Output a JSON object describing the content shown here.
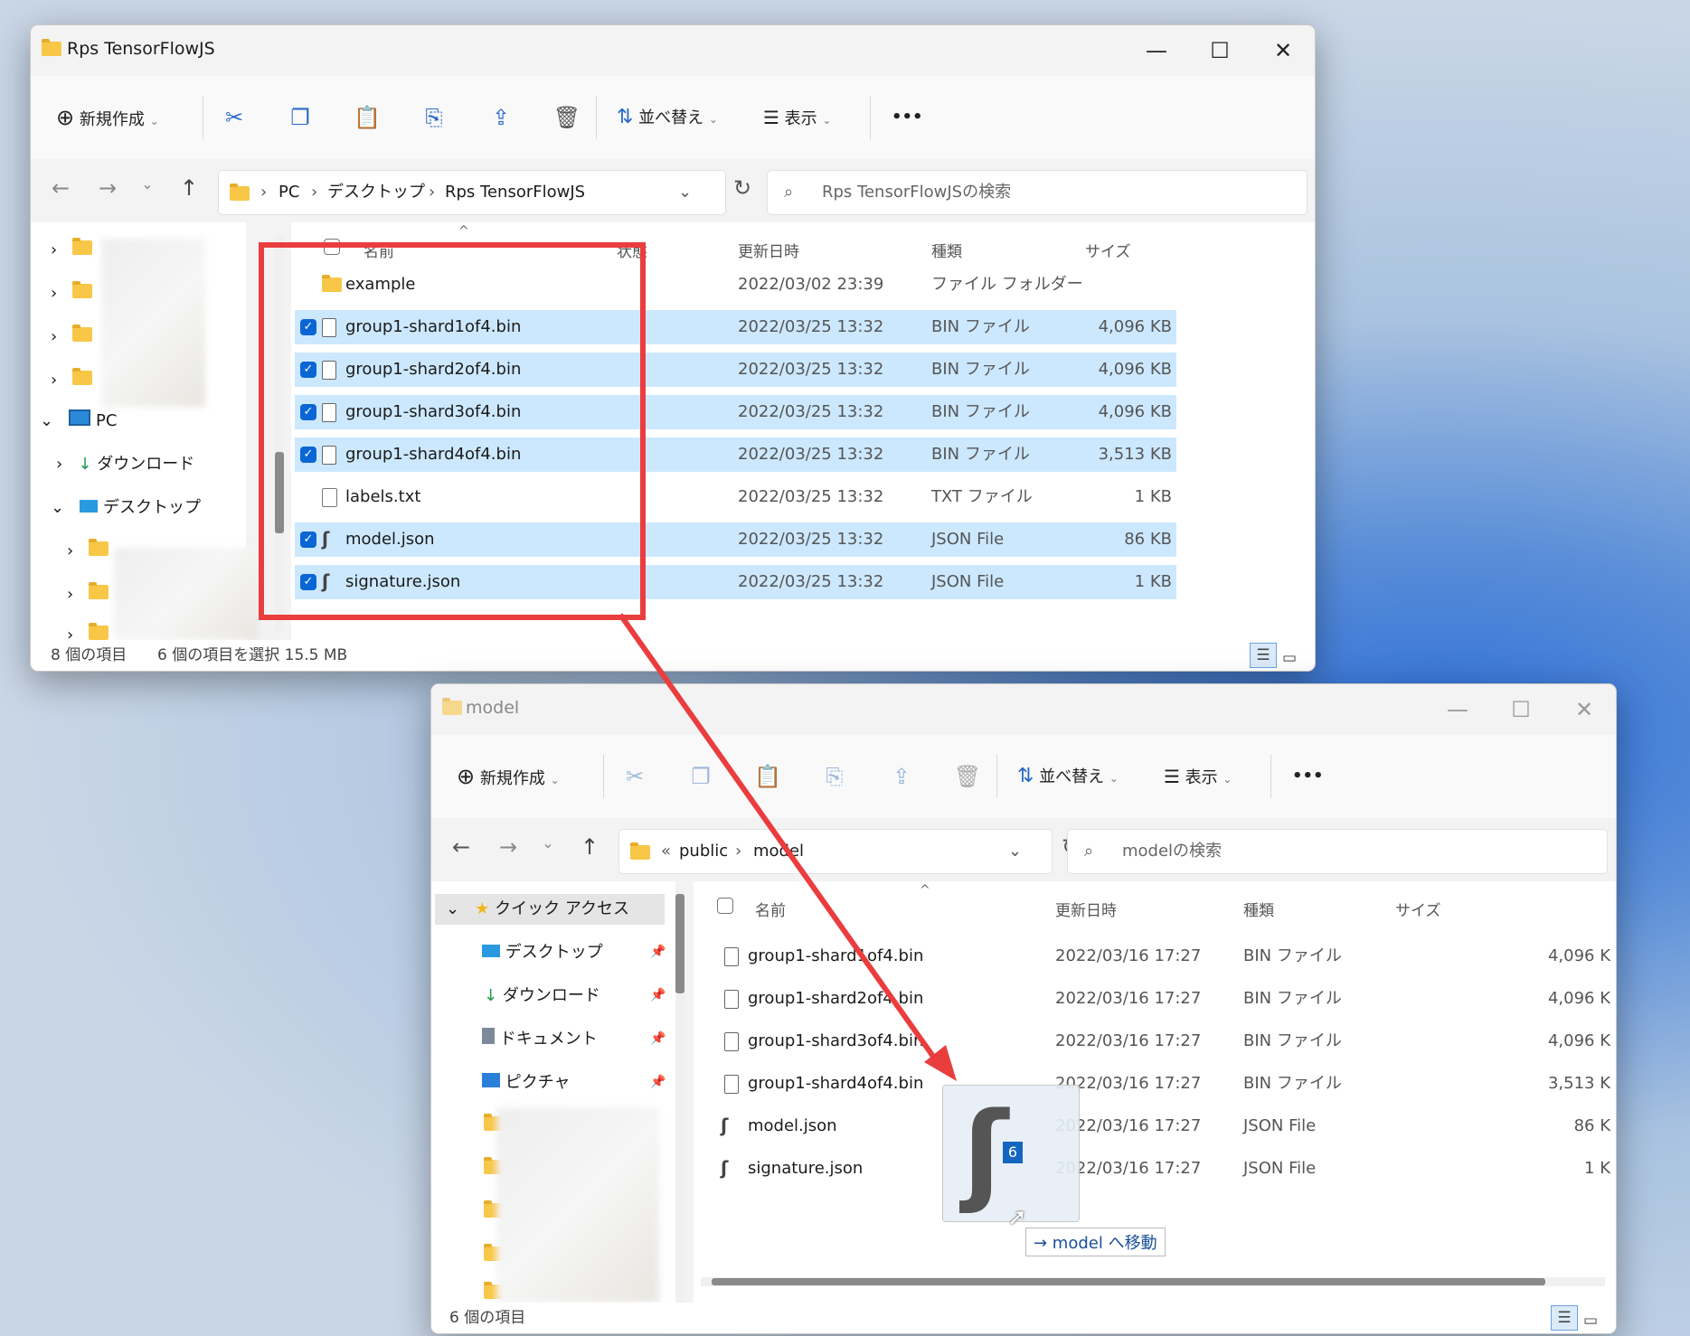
{
  "win1": {
    "title": "Rps TensorFlowJS",
    "toolbar": {
      "new_label": "新規作成",
      "sort_label": "並べ替え",
      "view_label": "表示",
      "more": "•••"
    },
    "address": {
      "pc": "PC",
      "desktop": "デスクトップ",
      "folder": "Rps TensorFlowJS"
    },
    "search_placeholder": "Rps TensorFlowJSの検索",
    "columns": {
      "name": "名前",
      "state": "状態",
      "modified": "更新日時",
      "type": "種類",
      "size": "サイズ"
    },
    "files": [
      {
        "name": "example",
        "date": "2022/03/02 23:39",
        "type": "ファイル フォルダー",
        "size": "",
        "icon": "folder-icon",
        "selected": false
      },
      {
        "name": "group1-shard1of4.bin",
        "date": "2022/03/25 13:32",
        "type": "BIN ファイル",
        "size": "4,096 KB",
        "icon": "file-icon",
        "selected": true
      },
      {
        "name": "group1-shard2of4.bin",
        "date": "2022/03/25 13:32",
        "type": "BIN ファイル",
        "size": "4,096 KB",
        "icon": "file-icon",
        "selected": true
      },
      {
        "name": "group1-shard3of4.bin",
        "date": "2022/03/25 13:32",
        "type": "BIN ファイル",
        "size": "4,096 KB",
        "icon": "file-icon",
        "selected": true
      },
      {
        "name": "group1-shard4of4.bin",
        "date": "2022/03/25 13:32",
        "type": "BIN ファイル",
        "size": "3,513 KB",
        "icon": "file-icon",
        "selected": true
      },
      {
        "name": "labels.txt",
        "date": "2022/03/25 13:32",
        "type": "TXT ファイル",
        "size": "1 KB",
        "icon": "text-file-icon",
        "selected": false
      },
      {
        "name": "model.json",
        "date": "2022/03/25 13:32",
        "type": "JSON File",
        "size": "86 KB",
        "icon": "json-file-icon",
        "selected": true
      },
      {
        "name": "signature.json",
        "date": "2022/03/25 13:32",
        "type": "JSON File",
        "size": "1 KB",
        "icon": "json-file-icon",
        "selected": true
      }
    ],
    "nav": {
      "pc": "PC",
      "downloads": "ダウンロード",
      "desktop": "デスクトップ"
    },
    "status": {
      "count": "8 個の項目",
      "selected": "6 個の項目を選択  15.5 MB"
    }
  },
  "win2": {
    "title": "model",
    "toolbar": {
      "new_label": "新規作成",
      "sort_label": "並べ替え",
      "view_label": "表示",
      "more": "•••"
    },
    "address": {
      "prefix": "«",
      "public": "public",
      "folder": "model"
    },
    "search_placeholder": "modelの検索",
    "columns": {
      "name": "名前",
      "modified": "更新日時",
      "type": "種類",
      "size": "サイズ"
    },
    "files": [
      {
        "name": "group1-shard1of4.bin",
        "date": "2022/03/16 17:27",
        "type": "BIN ファイル",
        "size": "4,096 K"
      },
      {
        "name": "group1-shard2of4.bin",
        "date": "2022/03/16 17:27",
        "type": "BIN ファイル",
        "size": "4,096 K"
      },
      {
        "name": "group1-shard3of4.bin",
        "date": "2022/03/16 17:27",
        "type": "BIN ファイル",
        "size": "4,096 K"
      },
      {
        "name": "group1-shard4of4.bin",
        "date": "2022/03/16 17:27",
        "type": "BIN ファイル",
        "size": "3,513 K"
      },
      {
        "name": "model.json",
        "date": "2022/03/16 17:27",
        "type": "JSON File",
        "size": "86 K"
      },
      {
        "name": "signature.json",
        "date": "2022/03/16 17:27",
        "type": "JSON File",
        "size": "1 K"
      }
    ],
    "nav": {
      "quick": "クイック アクセス",
      "desktop": "デスクトップ",
      "downloads": "ダウンロード",
      "documents": "ドキュメント",
      "pictures": "ピクチャ"
    },
    "status": {
      "count": "6 個の項目"
    }
  },
  "drag": {
    "count": "6",
    "tooltip": "→ model へ移動"
  },
  "colors": {
    "selection": "#cce8ff",
    "accent": "#0a66d4",
    "annotation": "#ea3d3d"
  }
}
